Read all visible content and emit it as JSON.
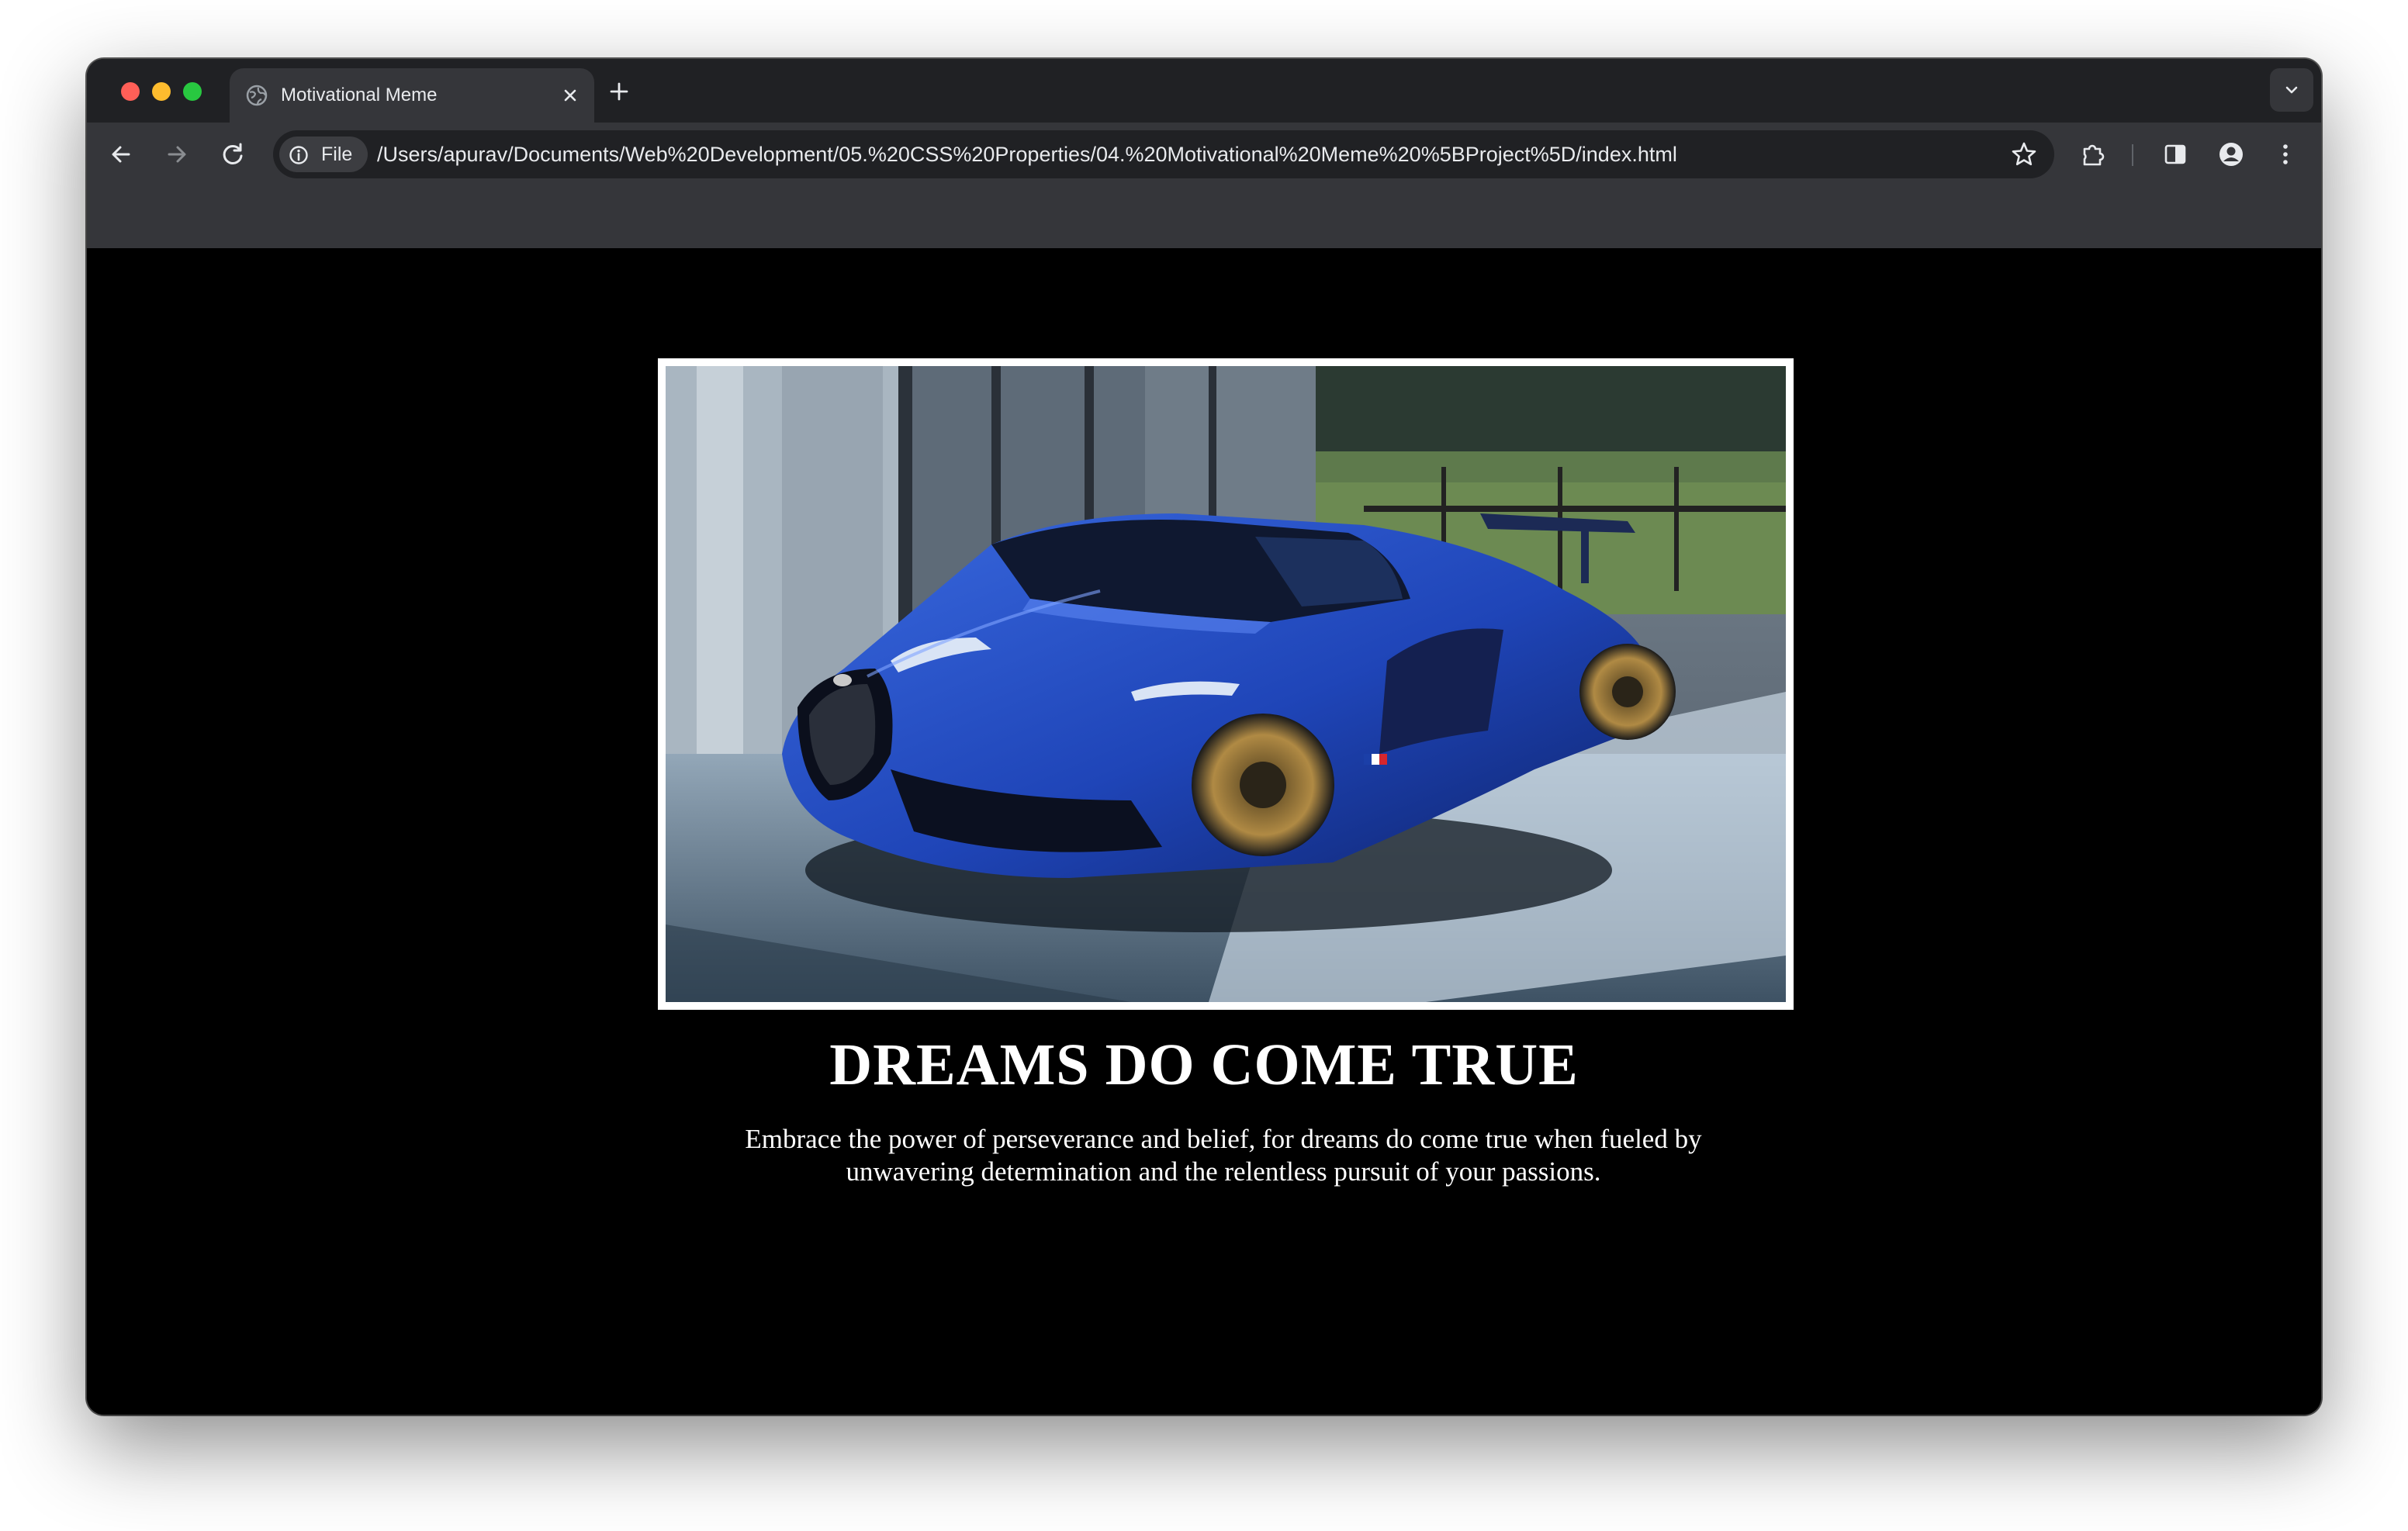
{
  "browser": {
    "tab": {
      "title": "Motivational Meme",
      "icon": "globe-icon"
    },
    "address_bar": {
      "scheme_label": "File",
      "url": "/Users/apurav/Documents/Web%20Development/05.%20CSS%20Properties/04.%20Motivational%20Meme%20%5BProject%5D/index.html"
    },
    "toolbar_icons": [
      "back-arrow-icon",
      "forward-arrow-icon",
      "reload-icon",
      "info-icon",
      "star-icon",
      "extensions-icon",
      "side-panel-icon",
      "profile-icon",
      "more-vert-icon"
    ]
  },
  "page": {
    "image": {
      "subject": "blue sports car",
      "frame_color": "#ffffff"
    },
    "headline": "DREAMS DO COME TRUE",
    "caption": "Embrace the power of perseverance and belief, for dreams do come true when fueled by unwavering determination and the relentless pursuit of your passions.",
    "background_color": "#000000",
    "text_color": "#ffffff"
  }
}
